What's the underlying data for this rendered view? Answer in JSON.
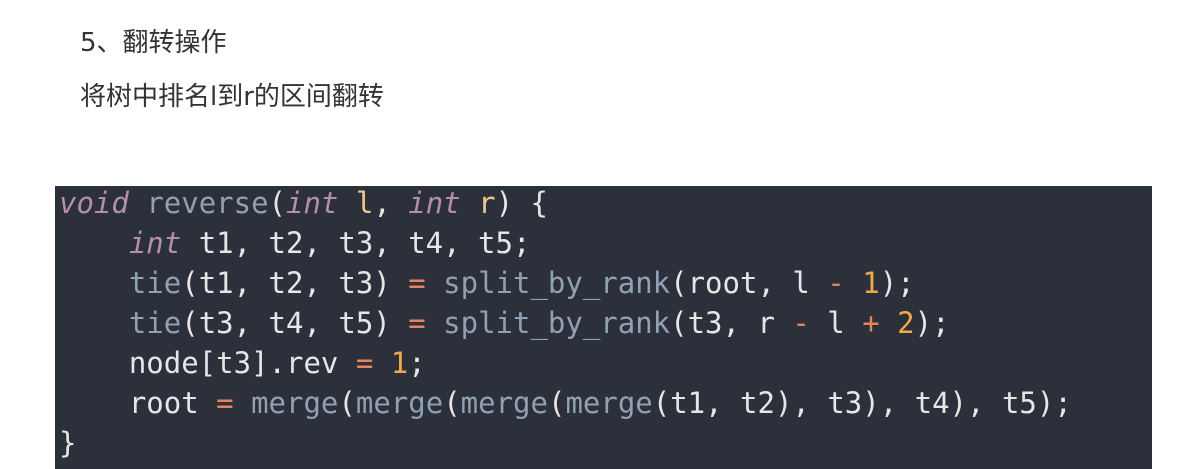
{
  "section": {
    "heading": "5、翻转操作",
    "description": "将树中排名l到r的区间翻转"
  },
  "code": {
    "line1": {
      "kw1": "void",
      "sp1": " ",
      "fn": "reverse",
      "p1": "(",
      "kw2": "int",
      "sp2": " ",
      "param1": "l",
      "comma": ", ",
      "kw3": "int",
      "sp3": " ",
      "param2": "r",
      "p2": ") {"
    },
    "line2": {
      "indent": "    ",
      "kw": "int",
      "rest": " t1, t2, t3, t4, t5;"
    },
    "line3": {
      "indent": "    ",
      "fn1": "tie",
      "a": "(t1, t2, t3) ",
      "op": "=",
      "sp": " ",
      "fn2": "split_by_rank",
      "b": "(root, l ",
      "op2": "-",
      "sp2": " ",
      "num": "1",
      "c": ");"
    },
    "line4": {
      "indent": "    ",
      "fn1": "tie",
      "a": "(t3, t4, t5) ",
      "op": "=",
      "sp": " ",
      "fn2": "split_by_rank",
      "b": "(t3, r ",
      "op2": "-",
      "c": " l ",
      "op3": "+",
      "sp3": " ",
      "num": "2",
      "d": ");"
    },
    "line5": {
      "indent": "    ",
      "a": "node[t3].rev ",
      "op": "=",
      "sp": " ",
      "num": "1",
      "b": ";"
    },
    "line6": {
      "indent": "    ",
      "a": "root ",
      "op": "=",
      "sp": " ",
      "fn1": "merge",
      "p1": "(",
      "fn2": "merge",
      "p2": "(",
      "fn3": "merge",
      "p3": "(",
      "fn4": "merge",
      "b": "(t1, t2), t3), t4), t5);"
    },
    "line7": {
      "a": "}"
    }
  },
  "colors": {
    "code_background": "#2b303b",
    "keyword": "#b48ead",
    "function": "#8fa1b3",
    "parameter": "#ebcb8b",
    "operator": "#e8825c",
    "number": "#f0a84a",
    "text": "#e6e6e6"
  }
}
